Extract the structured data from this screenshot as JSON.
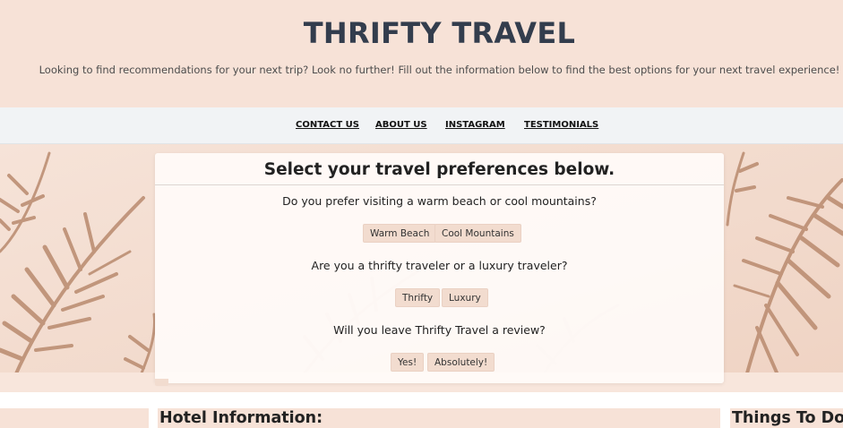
{
  "header": {
    "title": "THRIFTY TRAVEL",
    "tagline": "Looking to find recommendations for your next trip? Look no further! Fill out the information below to find the best options for your next travel experience!"
  },
  "nav": {
    "items": [
      "CONTACT US",
      "ABOUT US",
      "INSTAGRAM",
      "TESTIMONIALS"
    ]
  },
  "preferences": {
    "title": "Select your travel preferences below.",
    "questions": [
      {
        "text": "Do you prefer visiting a warm beach or cool mountains?",
        "options": [
          "Warm Beach",
          "Cool Mountains"
        ]
      },
      {
        "text": "Are you a thrifty traveler or a luxury traveler?",
        "options": [
          "Thrifty",
          "Luxury"
        ]
      },
      {
        "text": "Will you leave Thrifty Travel a review?",
        "options": [
          "Yes!",
          "Absolutely!"
        ]
      }
    ]
  },
  "sections": {
    "hotel_heading": "Hotel Information:",
    "things_heading": "Things To Do:"
  },
  "colors": {
    "header_bg": "#f7e2d7",
    "title": "#333d4d",
    "nav_bg": "#f1f3f5",
    "button_bg": "#f2dccf"
  },
  "background_image": "palm-leaf-shadows"
}
